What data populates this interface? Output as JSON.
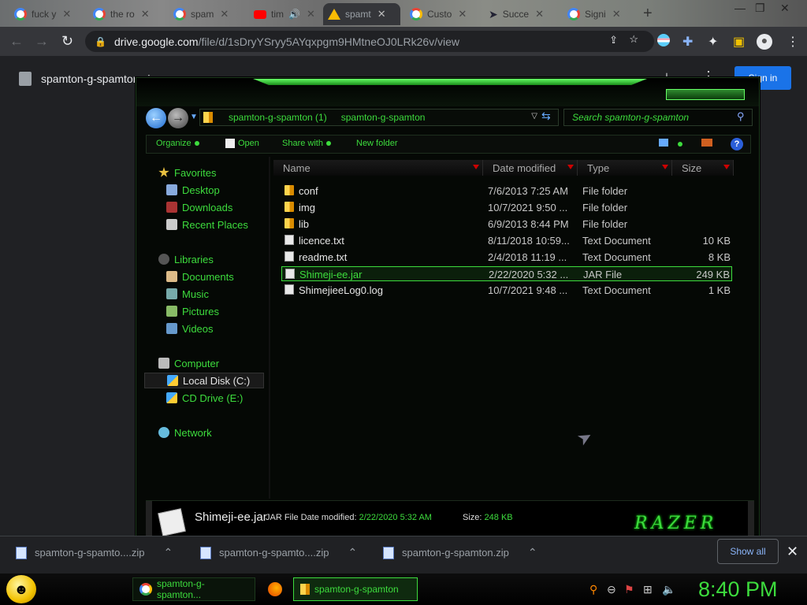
{
  "browser": {
    "tabs": [
      {
        "title": "fuck y",
        "icon": "google-icon"
      },
      {
        "title": "the ro",
        "icon": "google-icon"
      },
      {
        "title": "spam",
        "icon": "google-icon"
      },
      {
        "title": "tim",
        "icon": "youtube-icon"
      },
      {
        "title": "spamt",
        "icon": "drive-icon",
        "active": true
      },
      {
        "title": "Custo",
        "icon": "chrome-icon"
      },
      {
        "title": "Succe",
        "icon": "cursor-icon"
      },
      {
        "title": "Signi",
        "icon": "google-icon"
      }
    ],
    "url_host": "drive.google.com",
    "url_path": "/file/d/1sDryYSryy5AYqxpgm9HMtneOJ0LRk26v/view"
  },
  "drive": {
    "filename": "spamton-g-spamton.zip",
    "signin_label": "Sign in"
  },
  "explorer": {
    "breadcrumb": [
      "spamton-g-spamton (1)",
      "spamton-g-spamton"
    ],
    "search_placeholder": "Search spamton-g-spamton",
    "commands": {
      "organize": "Organize",
      "open": "Open",
      "share": "Share with",
      "new_folder": "New folder",
      "help": "?"
    },
    "nav": {
      "favorites": "Favorites",
      "desktop": "Desktop",
      "downloads": "Downloads",
      "recent": "Recent Places",
      "libraries": "Libraries",
      "documents": "Documents",
      "music": "Music",
      "pictures": "Pictures",
      "videos": "Videos",
      "computer": "Computer",
      "local_disk": "Local Disk (C:)",
      "cd_drive": "CD Drive (E:)",
      "network": "Network"
    },
    "columns": {
      "name": "Name",
      "date": "Date modified",
      "type": "Type",
      "size": "Size"
    },
    "files": [
      {
        "name": "conf",
        "date": "7/6/2013 7:25 AM",
        "type": "File folder",
        "size": "",
        "kind": "folder"
      },
      {
        "name": "img",
        "date": "10/7/2021 9:50 ...",
        "type": "File folder",
        "size": "",
        "kind": "folder"
      },
      {
        "name": "lib",
        "date": "6/9/2013 8:44 PM",
        "type": "File folder",
        "size": "",
        "kind": "folder"
      },
      {
        "name": "licence.txt",
        "date": "8/11/2018 10:59...",
        "type": "Text Document",
        "size": "10 KB",
        "kind": "doc"
      },
      {
        "name": "readme.txt",
        "date": "2/4/2018 11:19 ...",
        "type": "Text Document",
        "size": "8 KB",
        "kind": "doc"
      },
      {
        "name": "Shimeji-ee.jar",
        "date": "2/22/2020 5:32 ...",
        "type": "JAR File",
        "size": "249 KB",
        "kind": "doc",
        "selected": true
      },
      {
        "name": "ShimejieeLog0.log",
        "date": "10/7/2021 9:48 ...",
        "type": "Text Document",
        "size": "1 KB",
        "kind": "doc"
      }
    ],
    "details": {
      "name": "Shimeji-ee.jar",
      "type_label": "JAR File Date modified:",
      "date": "2/22/2020 5:32 AM",
      "size_label": "Size:",
      "size": "248 KB",
      "brand": "RAZER"
    }
  },
  "downloads": {
    "items": [
      "spamton-g-spamto....zip",
      "spamton-g-spamto....zip",
      "spamton-g-spamton.zip"
    ],
    "show_all": "Show all"
  },
  "taskbar": {
    "items": [
      "spamton-g-spamton...",
      "spamton-g-spamton"
    ],
    "clock": "8:40 PM"
  },
  "colors": {
    "accent": "#3ddc3d",
    "chrome_dark": "#202124",
    "link_blue": "#1a73e8"
  }
}
